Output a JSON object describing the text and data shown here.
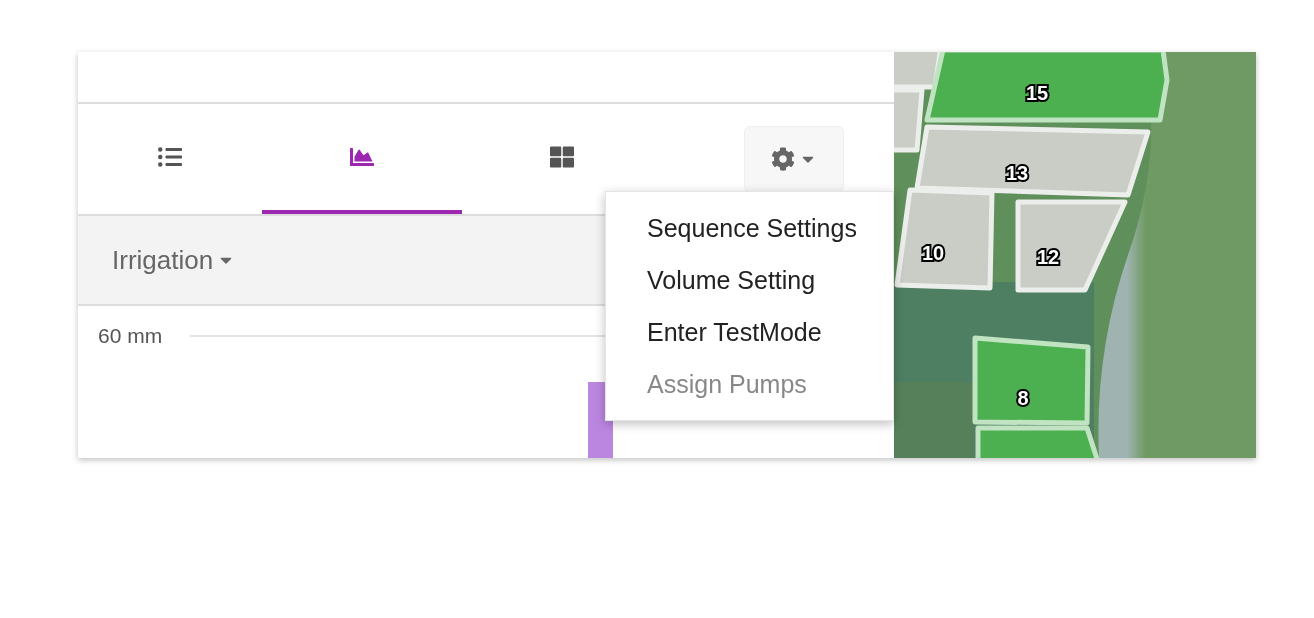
{
  "tabs": [
    {
      "selected": false
    },
    {
      "selected": true
    },
    {
      "selected": false
    }
  ],
  "settings_menu": {
    "expanded": true,
    "items": [
      {
        "label": "Sequence Settings",
        "disabled": false
      },
      {
        "label": "Volume Setting",
        "disabled": false
      },
      {
        "label": "Enter TestMode",
        "disabled": false
      },
      {
        "label": "Assign Pumps",
        "disabled": true
      }
    ]
  },
  "filter": {
    "label": "Irrigation"
  },
  "chart": {
    "axis_label": "60 mm"
  },
  "map": {
    "zones": [
      {
        "color": "#c9cdc6"
      },
      {
        "color": "#c9cdc6"
      },
      {
        "label": "15",
        "color": "#4caf50"
      },
      {
        "label": "13",
        "color": "#c9cdc6"
      },
      {
        "label": "10",
        "color": "#c9cdc6"
      },
      {
        "label": "12",
        "color": "#c9cdc6"
      },
      {
        "label": "8",
        "color": "#4caf50"
      },
      {
        "color": "#4caf50"
      }
    ]
  }
}
